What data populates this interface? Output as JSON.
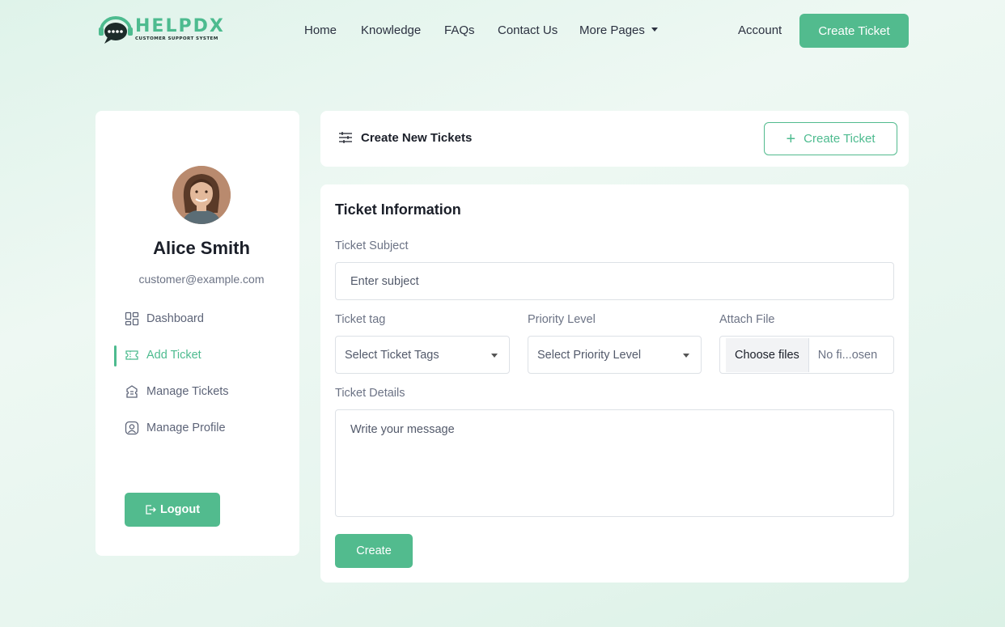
{
  "brand": {
    "name": "HELPDX",
    "tagline": "CUSTOMER SUPPORT SYSTEM",
    "accent": "#52bb8e"
  },
  "nav": {
    "items": [
      {
        "label": "Home"
      },
      {
        "label": "Knowledge"
      },
      {
        "label": "FAQs"
      },
      {
        "label": "Contact Us"
      },
      {
        "label": "More Pages"
      }
    ],
    "account_label": "Account",
    "create_ticket_label": "Create Ticket"
  },
  "sidebar": {
    "user_name": "Alice Smith",
    "user_email": "customer@example.com",
    "items": [
      {
        "label": "Dashboard",
        "icon": "dashboard-icon"
      },
      {
        "label": "Add Ticket",
        "icon": "ticket-icon",
        "active": true
      },
      {
        "label": "Manage Tickets",
        "icon": "tickets-icon"
      },
      {
        "label": "Manage Profile",
        "icon": "profile-icon"
      }
    ],
    "logout_label": "Logout"
  },
  "top_panel": {
    "title": "Create New Tickets",
    "button_label": "Create Ticket"
  },
  "form": {
    "title": "Ticket Information",
    "subject_label": "Ticket Subject",
    "subject_placeholder": "Enter subject",
    "tag_label": "Ticket tag",
    "tag_placeholder": "Select Ticket Tags",
    "priority_label": "Priority Level",
    "priority_placeholder": "Select Priority Level",
    "file_label": "Attach File",
    "file_button": "Choose files",
    "file_status": "No fi...osen",
    "details_label": "Ticket Details",
    "details_placeholder": "Write your message",
    "submit_label": "Create"
  }
}
